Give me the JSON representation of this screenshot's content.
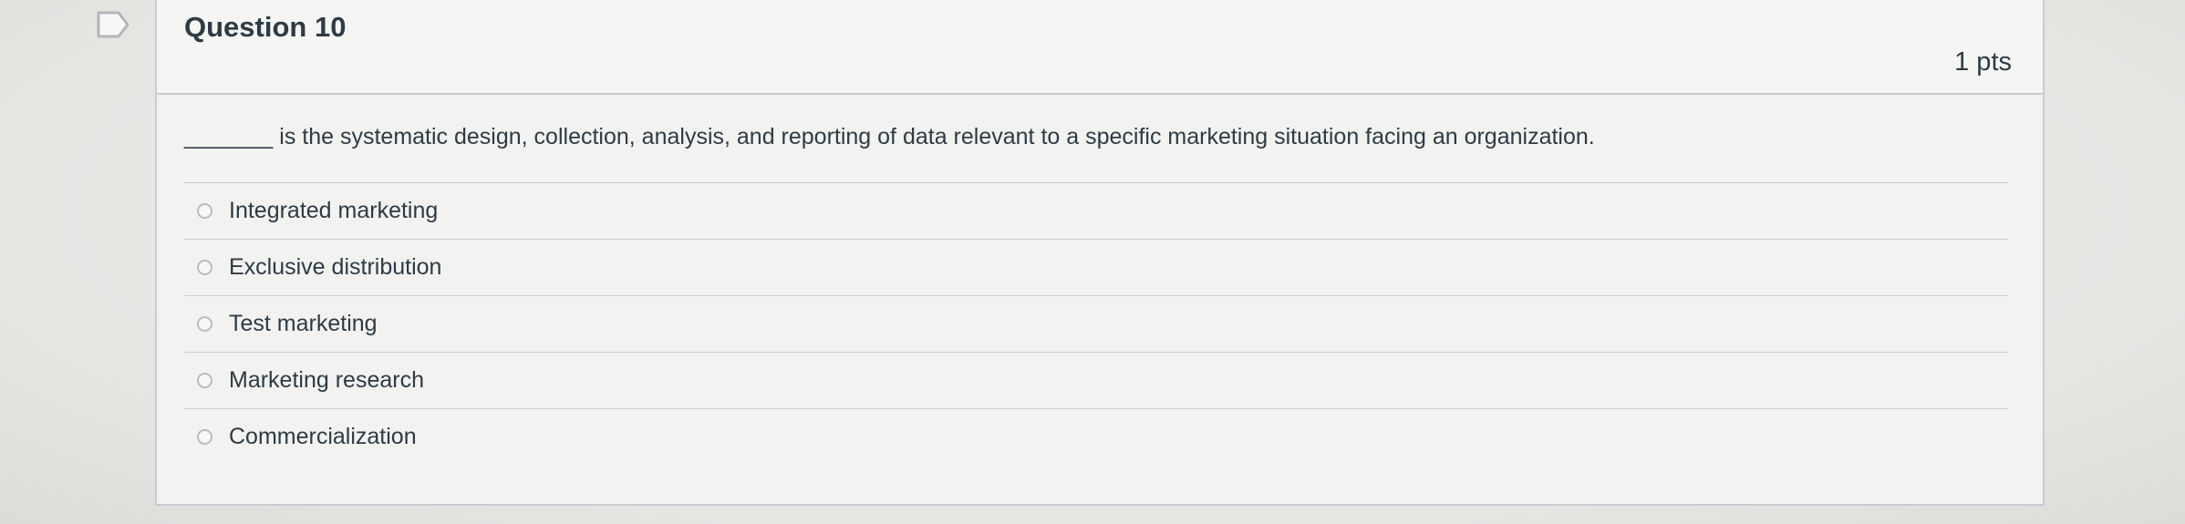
{
  "question": {
    "title": "Question 10",
    "points": "1 pts",
    "text": "_______ is the systematic design, collection, analysis, and reporting of data relevant to a specific marketing situation facing an organization."
  },
  "answers": [
    {
      "label": "Integrated marketing",
      "selected": false
    },
    {
      "label": "Exclusive distribution",
      "selected": false
    },
    {
      "label": "Test marketing",
      "selected": false
    },
    {
      "label": "Marketing research",
      "selected": false
    },
    {
      "label": "Commercialization",
      "selected": false
    }
  ],
  "icons": {
    "flag": "flag-question-icon",
    "radio": "radio-button"
  },
  "colors": {
    "text": "#2d3b45",
    "border": "#c7cdd1",
    "background": "#e9e9e7"
  }
}
